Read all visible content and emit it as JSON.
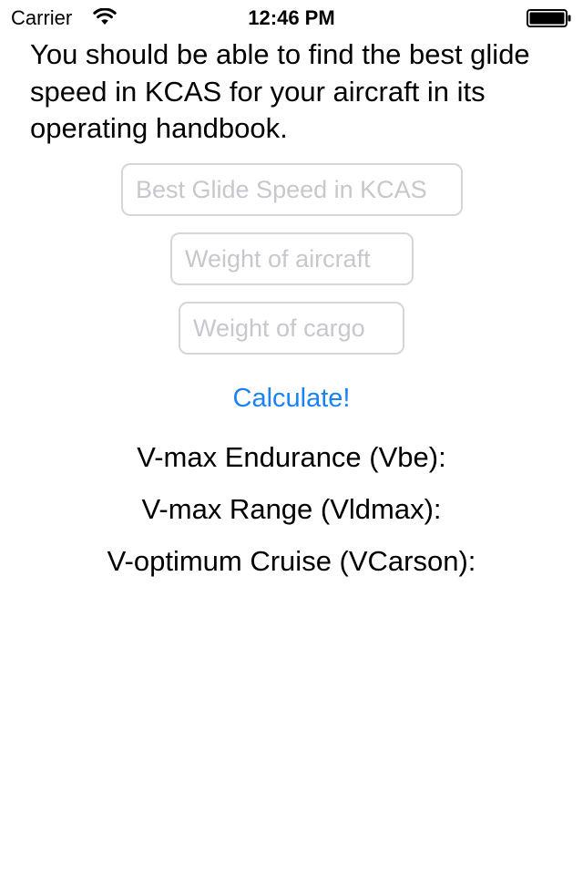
{
  "status_bar": {
    "carrier": "Carrier",
    "time": "12:46 PM",
    "icons": [
      "wifi-icon",
      "battery-icon"
    ]
  },
  "main": {
    "instructions": "You should be able to find the best glide speed in KCAS for your aircraft in its operating handbook.",
    "inputs": {
      "best_glide_speed": {
        "placeholder": "Best Glide Speed in KCAS",
        "value": ""
      },
      "aircraft_weight": {
        "placeholder": "Weight of aircraft",
        "value": ""
      },
      "cargo_weight": {
        "placeholder": "Weight of cargo",
        "value": ""
      }
    },
    "calculate_label": "Calculate!",
    "results": {
      "vbe": "V-max Endurance (Vbe):",
      "vldmax": "V-max Range (Vldmax):",
      "vcarson": "V-optimum Cruise (VCarson):"
    }
  },
  "colors": {
    "accent": "#1a82f7",
    "placeholder": "#c7c7cd",
    "field_border": "#d6d6d6",
    "background": "#ffffff",
    "text": "#000000"
  }
}
